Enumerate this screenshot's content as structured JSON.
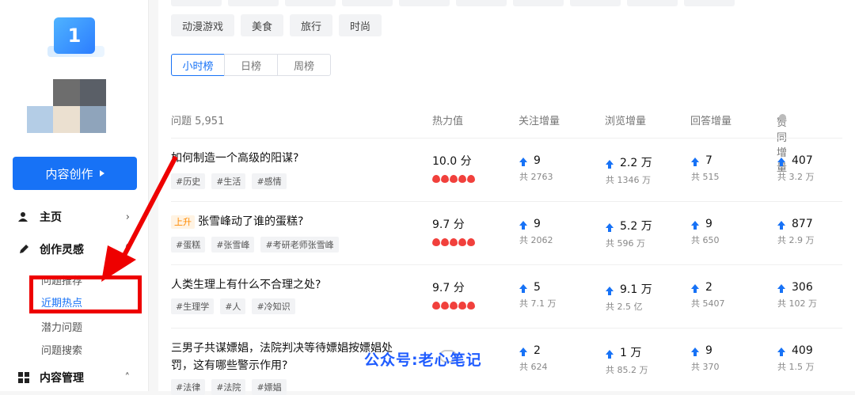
{
  "sidebar": {
    "logo_badge": "1",
    "create_button": "内容创作",
    "nav": {
      "home": "主页",
      "inspiration": "创作灵感",
      "content_mgmt": "内容管理"
    },
    "sub_items": {
      "question_recommend": "问题推荐",
      "recent_hot": "近期热点",
      "potential": "潜力问题",
      "search": "问题搜索"
    }
  },
  "main": {
    "category_chips": [
      "动漫游戏",
      "美食",
      "旅行",
      "时尚"
    ],
    "tabs": [
      "小时榜",
      "日榜",
      "周榜"
    ],
    "table": {
      "headers": {
        "question": "问题 5,951",
        "heat": "热力值",
        "follow": "关注增量",
        "view": "浏览增量",
        "answer": "回答增量",
        "like": "赞同增量"
      },
      "rows": [
        {
          "title": "如何制造一个高级的阳谋?",
          "badge": "",
          "tags": [
            "#历史",
            "#生活",
            "#感情"
          ],
          "heat": "10.0 分",
          "follow": "9",
          "follow_total": "共 2763",
          "view": "2.2 万",
          "view_total": "共 1346 万",
          "answer": "7",
          "answer_total": "共 515",
          "like": "407",
          "like_total": "共 3.2 万"
        },
        {
          "title": "张雪峰动了谁的蛋糕?",
          "badge": "上升",
          "tags": [
            "#蛋糕",
            "#张雪峰",
            "#考研老师张雪峰"
          ],
          "heat": "9.7 分",
          "follow": "9",
          "follow_total": "共 2062",
          "view": "5.2 万",
          "view_total": "共 596 万",
          "answer": "9",
          "answer_total": "共 650",
          "like": "877",
          "like_total": "共 2.9 万"
        },
        {
          "title": "人类生理上有什么不合理之处?",
          "badge": "",
          "tags": [
            "#生理学",
            "#人",
            "#冷知识"
          ],
          "heat": "9.7 分",
          "follow": "5",
          "follow_total": "共 7.1 万",
          "view": "9.1 万",
          "view_total": "共 2.5 亿",
          "answer": "2",
          "answer_total": "共 5407",
          "like": "306",
          "like_total": "共 102 万"
        },
        {
          "title": "三男子共谋嫖娼，法院判决等待嫖娼按嫖娼处罚，这有哪些警示作用?",
          "badge": "",
          "tags": [
            "#法律",
            "#法院",
            "#嫖娼"
          ],
          "heat": "",
          "follow": "2",
          "follow_total": "共 624",
          "view": "1 万",
          "view_total": "共 85.2 万",
          "answer": "9",
          "answer_total": "共 370",
          "like": "409",
          "like_total": "共 1.5 万"
        }
      ]
    }
  },
  "watermark": "公众号:老心笔记",
  "colors": {
    "accent": "#1772f6",
    "highlight_red": "#ee0000",
    "flame": "#f1403c"
  }
}
